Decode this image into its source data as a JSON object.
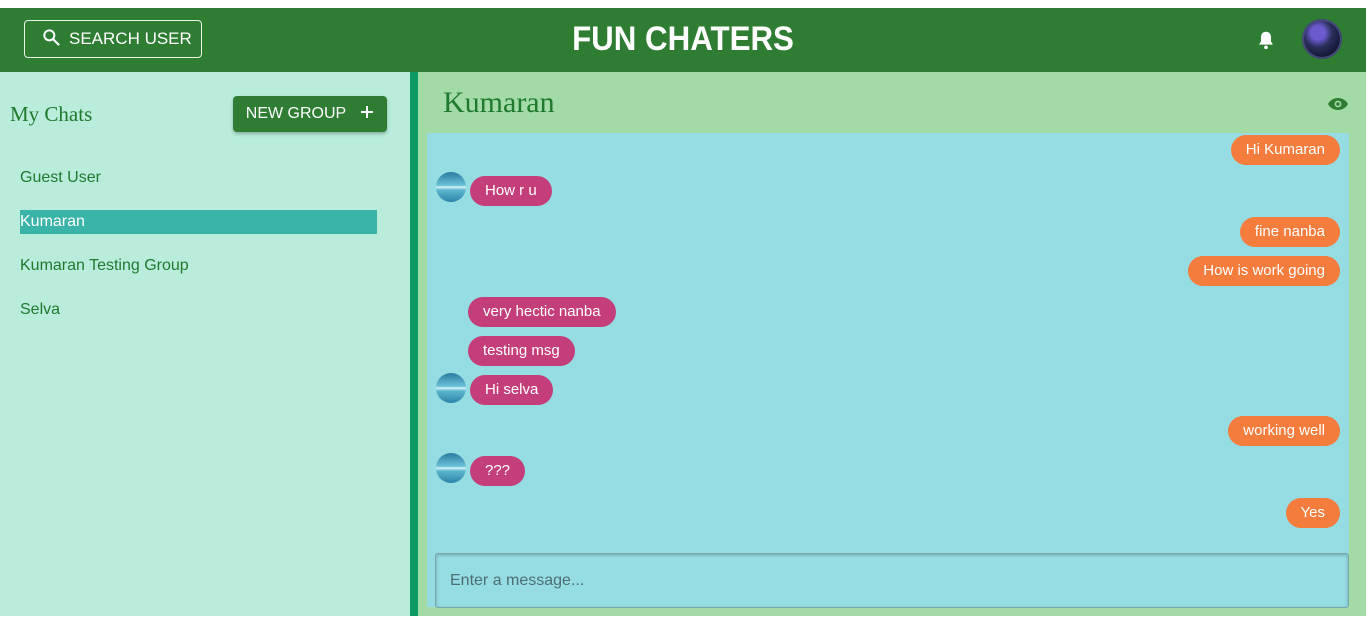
{
  "header": {
    "search_label": "SEARCH USER",
    "title": "FUN CHATERS"
  },
  "sidebar": {
    "title": "My Chats",
    "new_group_label": "NEW GROUP",
    "chats": [
      "Guest User",
      "Kumaran",
      "Kumaran Testing Group",
      "Selva"
    ],
    "active_chat": "Kumaran"
  },
  "chat": {
    "name": "Kumaran",
    "messages": [
      {
        "text": "Hi Kumaran",
        "mine": true,
        "avatar": false
      },
      {
        "text": "How r u",
        "mine": false,
        "avatar": true
      },
      {
        "text": "fine nanba",
        "mine": true,
        "avatar": false
      },
      {
        "text": "How is work going",
        "mine": true,
        "avatar": false
      },
      {
        "text": "very hectic nanba",
        "mine": false,
        "avatar": false
      },
      {
        "text": "testing msg",
        "mine": false,
        "avatar": false
      },
      {
        "text": "Hi selva",
        "mine": false,
        "avatar": true
      },
      {
        "text": "working well",
        "mine": true,
        "avatar": false
      },
      {
        "text": "???",
        "mine": false,
        "avatar": true
      },
      {
        "text": "Yes",
        "mine": true,
        "avatar": false
      }
    ],
    "input_placeholder": "Enter a message..."
  },
  "colors": {
    "header": "#2e7d32",
    "sidebar": "#b9ecdb",
    "chat_panel": "#a3dba7",
    "messages_bg": "#95dde3",
    "mine_bubble": "#f47c3c",
    "their_bubble": "#c43f7a",
    "active_chat": "#3ab3a8"
  },
  "icons": [
    "search-icon",
    "bell-icon",
    "user-avatar",
    "plus-icon",
    "eye-icon"
  ]
}
